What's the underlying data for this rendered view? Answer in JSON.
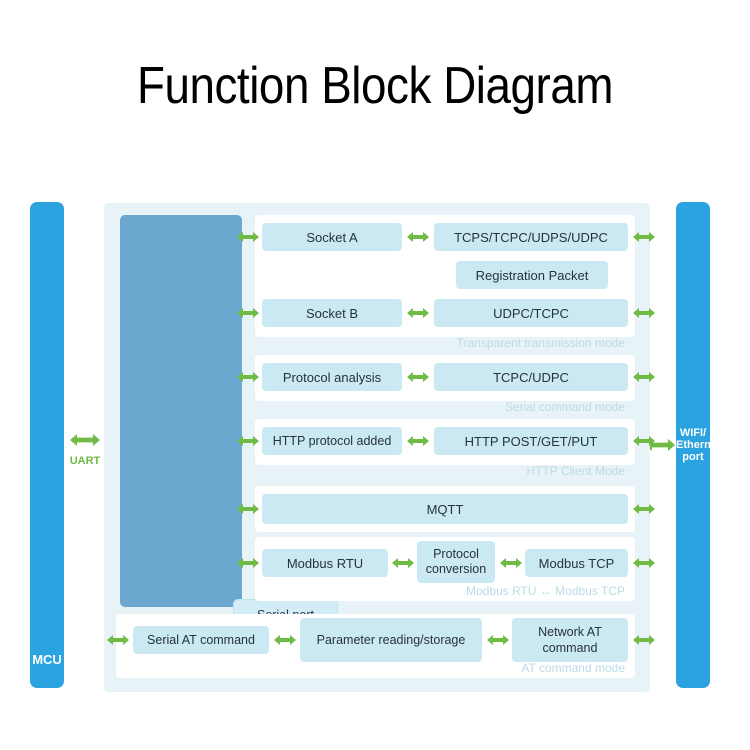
{
  "title": "Function Block Diagram",
  "left_rail": {
    "label": "MCU",
    "bus_label": "UART"
  },
  "right_rail": {
    "label": "WIFI/\nEthernet\nport",
    "line1": "WIFI/",
    "line2": "Ethernet",
    "line3": "port"
  },
  "serial": {
    "label": "Serial port packaging"
  },
  "sections": [
    {
      "name": "transparent-transmission",
      "mode_label": "Transparent transmission mode",
      "blocks": [
        {
          "name": "socket-a",
          "label": "Socket A"
        },
        {
          "name": "tcps-tcpc-udps-udpc",
          "label": "TCPS/TCPC/UDPS/UDPC"
        },
        {
          "name": "registration-packet",
          "label": "Registration Packet"
        },
        {
          "name": "socket-b",
          "label": "Socket B"
        },
        {
          "name": "udpc-tcpc",
          "label": "UDPC/TCPC"
        }
      ]
    },
    {
      "name": "serial-command",
      "mode_label": "Serial command mode",
      "blocks": [
        {
          "name": "protocol-analysis",
          "label": "Protocol analysis"
        },
        {
          "name": "tcpc-udpc",
          "label": "TCPC/UDPC"
        }
      ]
    },
    {
      "name": "http-client",
      "mode_label": "HTTP Client Mode",
      "blocks": [
        {
          "name": "http-protocol-added",
          "label": "HTTP protocol added"
        },
        {
          "name": "http-post-get-put",
          "label": "HTTP POST/GET/PUT"
        }
      ]
    },
    {
      "name": "mqtt",
      "mode_label": "",
      "blocks": [
        {
          "name": "mqtt",
          "label": "MQTT"
        }
      ]
    },
    {
      "name": "modbus",
      "mode_label": "Modbus RTU ↔ Modbus TCP",
      "blocks": [
        {
          "name": "modbus-rtu",
          "label": "Modbus RTU"
        },
        {
          "name": "protocol-conversion",
          "label": "Protocol conversion"
        },
        {
          "name": "modbus-tcp",
          "label": "Modbus TCP"
        }
      ]
    },
    {
      "name": "at-command",
      "mode_label": "AT command mode",
      "blocks": [
        {
          "name": "serial-at-command",
          "label": "Serial AT command"
        },
        {
          "name": "parameter-reading-storage",
          "label": "Parameter reading/storage"
        },
        {
          "name": "network-at-command",
          "label": "Network AT command"
        }
      ]
    }
  ],
  "colors": {
    "rail": "#2ba3e0",
    "serial_bar": "#6ba7cf",
    "block": "#cbe9f2",
    "container": "#e8f3f8",
    "panel": "#ffffff",
    "arrow": "#6fbb46",
    "mode_label": "#bcdbe6"
  }
}
